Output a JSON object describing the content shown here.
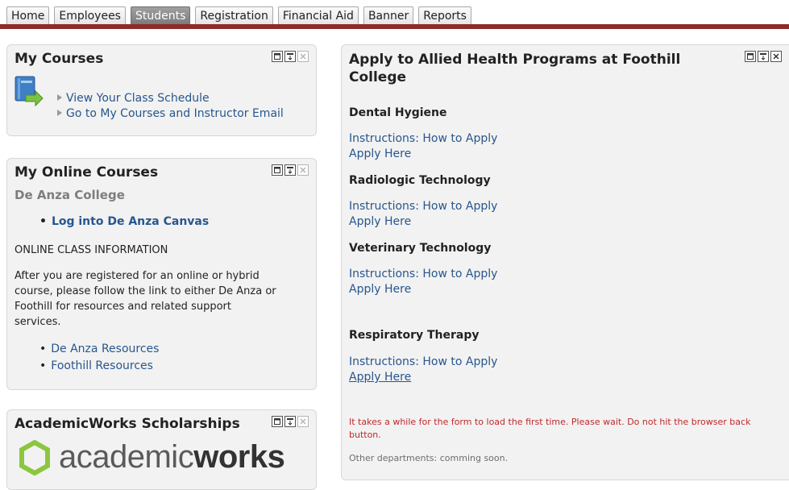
{
  "tabs": [
    "Home",
    "Employees",
    "Students",
    "Registration",
    "Financial Aid",
    "Banner",
    "Reports"
  ],
  "active_tab": "Students",
  "colors": {
    "tab_underline": "#8e2b2b",
    "link": "#27568e",
    "warning": "#c0282e"
  },
  "my_courses": {
    "title": "My Courses",
    "icon": "book-arrow-icon",
    "links": [
      "View Your Class Schedule",
      "Go to My Courses and Instructor Email"
    ]
  },
  "online_courses": {
    "title": "My Online Courses",
    "college": "De Anza College",
    "canvas_link": "Log into De Anza Canvas",
    "section_heading": "ONLINE CLASS INFORMATION",
    "info_lines": [
      "After you are registered for an online or hybrid",
      "course, please follow the link to either De Anza or",
      "Foothill for resources and related support",
      "services."
    ],
    "resources": [
      "De Anza Resources",
      "Foothill Resources"
    ]
  },
  "academicworks": {
    "title": "AcademicWorks Scholarships",
    "logo_text_light": "academic",
    "logo_text_bold": "works"
  },
  "allied": {
    "title_line1": "Apply to Allied Health Programs at Foothill",
    "title_line2": "College",
    "programs": [
      {
        "name": "Dental Hygiene",
        "instructions": "Instructions: How to Apply",
        "apply": "Apply Here"
      },
      {
        "name": "Radiologic Technology",
        "instructions": "Instructions: How to Apply",
        "apply": "Apply Here"
      },
      {
        "name": "Veterinary Technology",
        "instructions": "Instructions: How to Apply",
        "apply": "Apply Here"
      },
      {
        "name": "Respiratory Therapy",
        "instructions": "Instructions: How to Apply",
        "apply": "Apply Here"
      }
    ],
    "warning": "It takes a while for the form to load the first time. Please wait. Do not hit the browser back button.",
    "note": "Other departments: comming soon."
  },
  "panel_controls": [
    "maximize-icon",
    "minimize-icon",
    "close-icon"
  ]
}
